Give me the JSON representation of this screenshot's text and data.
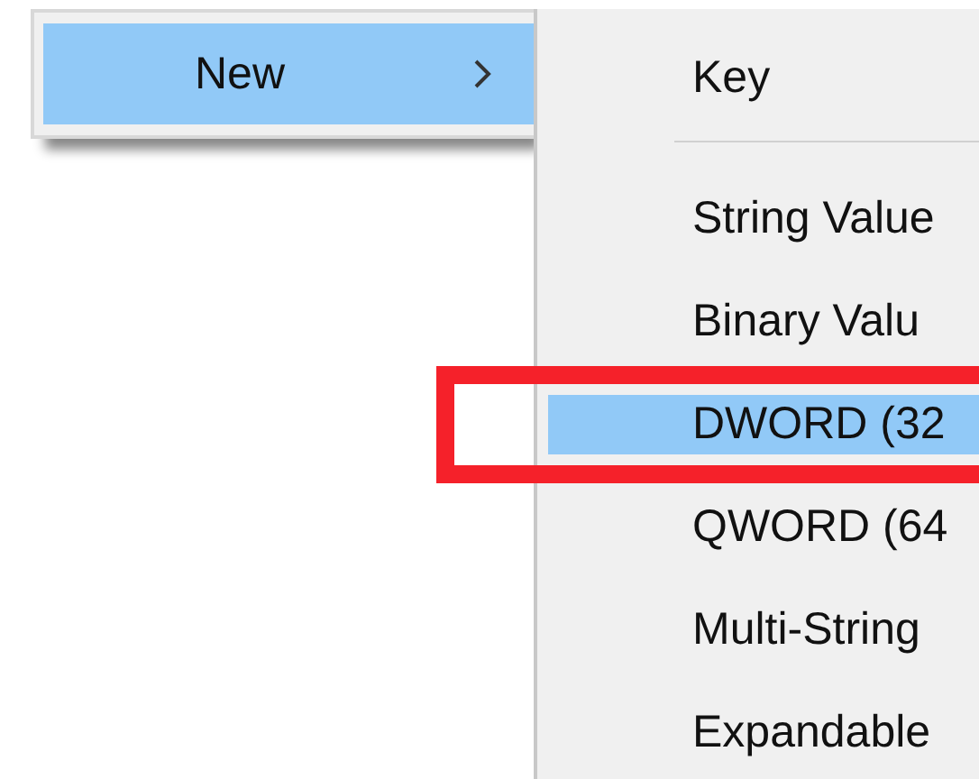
{
  "menu": {
    "items": [
      {
        "label": "New",
        "selected": true,
        "submenu": true
      }
    ]
  },
  "submenu": {
    "items": [
      {
        "kind": "item",
        "label": "Key",
        "selected": false,
        "outlined": false
      },
      {
        "kind": "separator"
      },
      {
        "kind": "item",
        "label": "String Value",
        "selected": false,
        "outlined": false
      },
      {
        "kind": "item",
        "label": "Binary Valu",
        "selected": false,
        "outlined": false
      },
      {
        "kind": "item",
        "label": "DWORD (32",
        "selected": true,
        "outlined": true
      },
      {
        "kind": "item",
        "label": "QWORD (64",
        "selected": false,
        "outlined": false
      },
      {
        "kind": "item",
        "label": "Multi-String",
        "selected": false,
        "outlined": false
      },
      {
        "kind": "item",
        "label": "Expandable",
        "selected": false,
        "outlined": false
      }
    ]
  }
}
